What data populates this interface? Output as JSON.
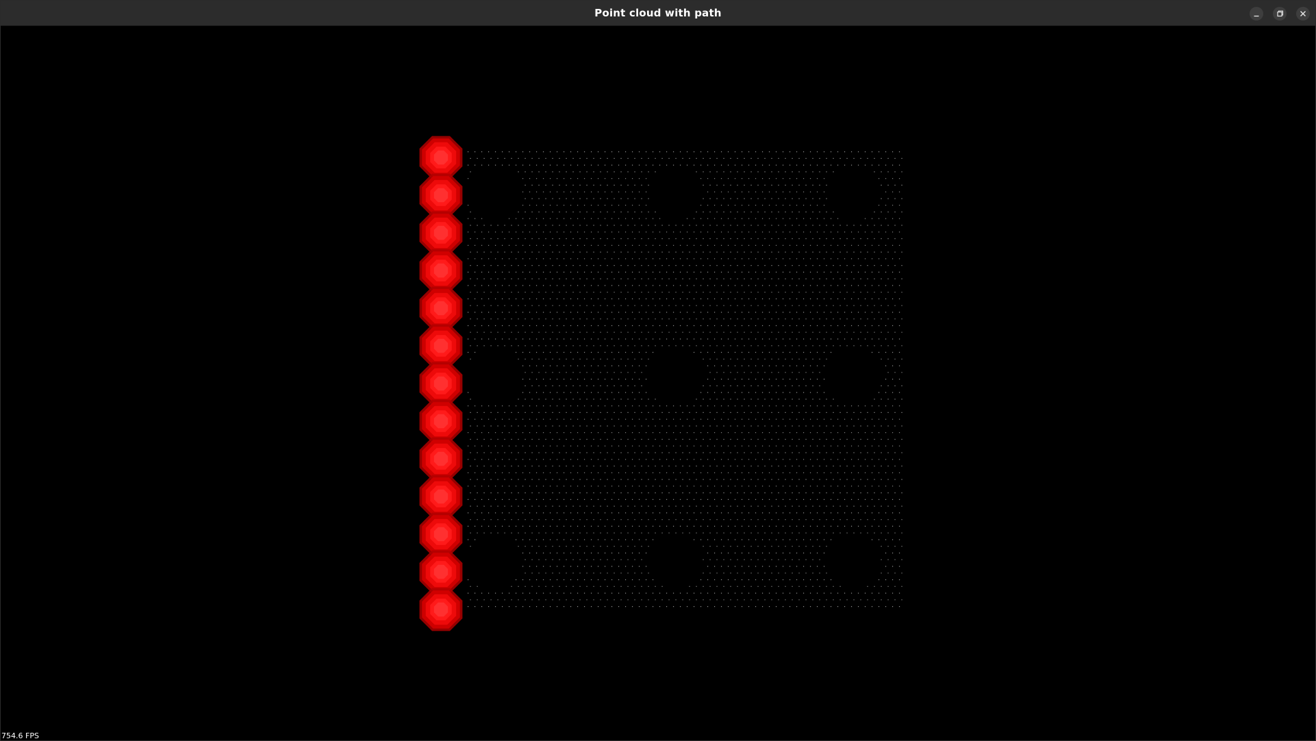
{
  "window": {
    "title": "Point cloud with path",
    "buttons": {
      "minimize_icon": "minimize-icon",
      "maximize_icon": "restore-icon",
      "close_icon": "close-icon"
    }
  },
  "scene": {
    "background_color": "#000000",
    "point_color": "#bdbdbd",
    "path_marker_color": "#ff1a1a",
    "path_marker_outer_color": "#b00000",
    "path_marker_count": 13,
    "grid_columns": 64,
    "grid_rows": 69
  },
  "status": {
    "fps": "754.6 FPS"
  }
}
